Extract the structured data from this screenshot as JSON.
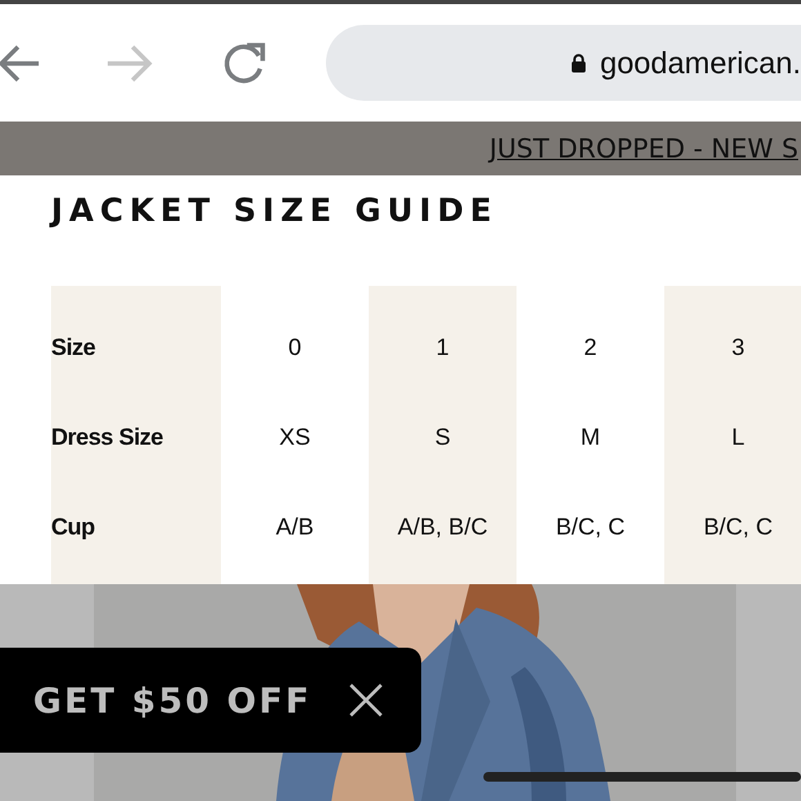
{
  "browser": {
    "nav": [
      {
        "kind": "back",
        "disabled": false
      },
      {
        "kind": "forward",
        "disabled": true
      },
      {
        "kind": "reload",
        "disabled": false
      }
    ],
    "url": "goodamerican."
  },
  "announcement": "JUST DROPPED - NEW S",
  "size_guide": {
    "title": "JACKET SIZE GUIDE",
    "rows": [
      {
        "label": "Size",
        "cells": [
          "0",
          "1",
          "2",
          "3"
        ]
      },
      {
        "label": "Dress Size",
        "cells": [
          "XS",
          "S",
          "M",
          "L"
        ]
      },
      {
        "label": "Cup",
        "cells": [
          "A/B",
          "A/B, B/C",
          "B/C, C",
          "B/C, C"
        ]
      }
    ]
  },
  "promo": {
    "label": "GET $50 OFF"
  }
}
